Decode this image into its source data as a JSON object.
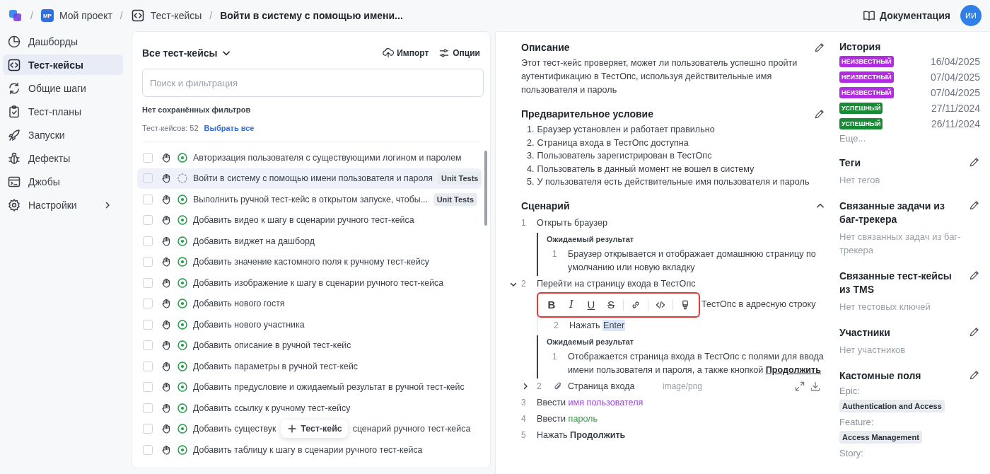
{
  "breadcrumb": {
    "separator": "/",
    "project_initials": "MP",
    "project": "Мой проект",
    "section": "Тест-кейсы",
    "current": "Войти в систему с помощью имени..."
  },
  "header": {
    "docs": "Документация",
    "user_initials": "ИИ"
  },
  "sidebar": {
    "items": [
      {
        "label": "Дашборды",
        "selected": false
      },
      {
        "label": "Тест-кейсы",
        "selected": true
      },
      {
        "label": "Общие шаги",
        "selected": false
      },
      {
        "label": "Тест-планы",
        "selected": false
      },
      {
        "label": "Запуски",
        "selected": false
      },
      {
        "label": "Дефекты",
        "selected": false
      },
      {
        "label": "Джобы",
        "selected": false
      },
      {
        "label": "Настройки",
        "selected": false,
        "has_submenu": true
      }
    ]
  },
  "list": {
    "title": "Все тест-кейсы",
    "import": "Импорт",
    "options": "Опции",
    "search": {
      "placeholder": "Поиск и фильтрация"
    },
    "saved_filters": "Нет сохранённых фильтров",
    "count": "Тест-кейсов: 52",
    "select_all": "Выбрать все",
    "add_button": "Тест-кейс",
    "rows": [
      {
        "title": "Авторизация пользователя с существующими логином и паролем",
        "kind": "active",
        "checked": false,
        "selected": false
      },
      {
        "title": "Войти в систему с помощью имени пользователя и пароля",
        "kind": "draft",
        "checked": false,
        "selected": true,
        "tag": "Unit Tests"
      },
      {
        "title": "Выполнить ручной тест-кейс в открытом запуске, чтобы...",
        "kind": "active",
        "checked": false,
        "selected": false,
        "tag": "Unit Tests"
      },
      {
        "title": "Добавить видео к шагу в сценарии ручного тест-кейса",
        "kind": "active",
        "checked": false,
        "selected": false
      },
      {
        "title": "Добавить виджет на дашборд",
        "kind": "active",
        "checked": false,
        "selected": false
      },
      {
        "title": "Добавить значение кастомного поля к ручному тест-кейсу",
        "kind": "active",
        "checked": false,
        "selected": false
      },
      {
        "title": "Добавить изображение к шагу в сценарии ручного тест-кейса",
        "kind": "active",
        "checked": false,
        "selected": false
      },
      {
        "title": "Добавить нового гостя",
        "kind": "active",
        "checked": false,
        "selected": false
      },
      {
        "title": "Добавить нового участника",
        "kind": "active",
        "checked": false,
        "selected": false
      },
      {
        "title": "Добавить описание в ручной тест-кейс",
        "kind": "active",
        "checked": false,
        "selected": false
      },
      {
        "title": "Добавить параметры в ручной тест-кейс",
        "kind": "active",
        "checked": false,
        "selected": false
      },
      {
        "title": "Добавить предусловие и ожидаемый результат в ручной тест-кейс",
        "kind": "active",
        "checked": false,
        "selected": false
      },
      {
        "title": "Добавить ссылку к ручному тест-кейсу",
        "kind": "active",
        "checked": false,
        "selected": false
      },
      {
        "title": "Добавить существук",
        "title_after": "сценарий ручного тест-кейса",
        "kind": "active",
        "checked": false,
        "selected": false
      },
      {
        "title": "Добавить таблицу к шагу в сценарии ручного тест-кейса",
        "kind": "active",
        "checked": false,
        "selected": false
      }
    ]
  },
  "description": {
    "title": "Описание",
    "text": "Этот тест-кейс проверяет, может ли пользователь успешно пройти аутентификацию в ТестОпс, используя действительные имя пользователя и пароль"
  },
  "precondition": {
    "title": "Предварительное условие",
    "items": [
      {
        "number": "1.",
        "text": "Браузер установлен и работает правильно"
      },
      {
        "number": "2.",
        "text": "Страница входа в ТестОпс доступна"
      },
      {
        "number": "3.",
        "text": "Пользователь зарегистрирован в ТестОпс"
      },
      {
        "number": "4.",
        "text": "Пользователь в данный момент не вошел в систему"
      },
      {
        "number": "5.",
        "text": "У пользователя есть действительные имя пользователя и пароль"
      }
    ]
  },
  "scenario": {
    "title": "Сценарий",
    "expanded": true,
    "toolbar": {
      "outlined": true,
      "buttons": [
        {
          "kind": "bold",
          "label": "B"
        },
        {
          "kind": "italic",
          "label": "I"
        },
        {
          "kind": "underline",
          "label": "U"
        },
        {
          "kind": "strike",
          "label": "S"
        },
        {
          "kind": "link"
        },
        {
          "kind": "code"
        },
        {
          "kind": "marker"
        }
      ]
    },
    "steps": [
      {
        "number": "1",
        "text": "Открыть браузер",
        "expected": {
          "label": "Ожидаемый результат",
          "items": [
            {
              "number": "1",
              "text": "Браузер открывается и отображает домашнюю страницу по умолчанию или новую вкладку"
            }
          ]
        }
      },
      {
        "number": "2",
        "text": "Перейти на страницу входа в ТестОпс",
        "expanded": true,
        "substeps": [
          {
            "kind": "under_toolbar",
            "text": "ТестОпс в адресную строку"
          },
          {
            "kind": "step",
            "number": "2",
            "text": "Нажать",
            "selected_text": "Enter"
          }
        ],
        "expected": {
          "label": "Ожидаемый результат",
          "items": [
            {
              "number": "1",
              "text": "Отображается страница входа в ТестОпс с полями для ввода имени пользователя и пароля, а также кнопкой",
              "strong": "Продолжить"
            }
          ]
        },
        "attachments": [
          {
            "number": "2",
            "name": "Страница входа",
            "type": "image/png",
            "expanded": false
          }
        ]
      },
      {
        "number": "3",
        "text": "Ввести",
        "param": "имя пользователя",
        "color": "#9b45e4"
      },
      {
        "number": "4",
        "text": "Ввести",
        "param": "пароль",
        "color": "#35a043"
      },
      {
        "number": "5",
        "text": "Нажать",
        "strong": "Продолжить"
      }
    ]
  },
  "history": {
    "title": "История",
    "entries": [
      {
        "status": "НЕИЗВЕСТНЫЙ",
        "color": "#b12ee0",
        "date": "16/04/2025"
      },
      {
        "status": "НЕИЗВЕСТНЫЙ",
        "color": "#b12ee0",
        "date": "07/04/2025"
      },
      {
        "status": "НЕИЗВЕСТНЫЙ",
        "color": "#b12ee0",
        "date": "07/04/2025"
      },
      {
        "status": "УСПЕШНЫЙ",
        "color": "#178a35",
        "date": "27/11/2024"
      },
      {
        "status": "УСПЕШНЫЙ",
        "color": "#178a35",
        "date": "26/11/2024"
      }
    ],
    "more": "Еще..."
  },
  "sections": [
    {
      "title": "Теги",
      "empty": "Нет тегов"
    },
    {
      "title": "Связанные задачи из баг-трекера",
      "empty": "Нет связанных задач из баг-трекера"
    },
    {
      "title": "Связанные тест-кейсы из TMS",
      "empty": "Нет тестовых ключей"
    },
    {
      "title": "Участники",
      "empty": "Нет участников"
    }
  ],
  "custom_fields": {
    "title": "Кастомные поля",
    "fields": [
      {
        "name": "Epic:",
        "value": "Authentication and Access"
      },
      {
        "name": "Feature:",
        "value": "Access Management"
      },
      {
        "name": "Story:"
      }
    ]
  }
}
